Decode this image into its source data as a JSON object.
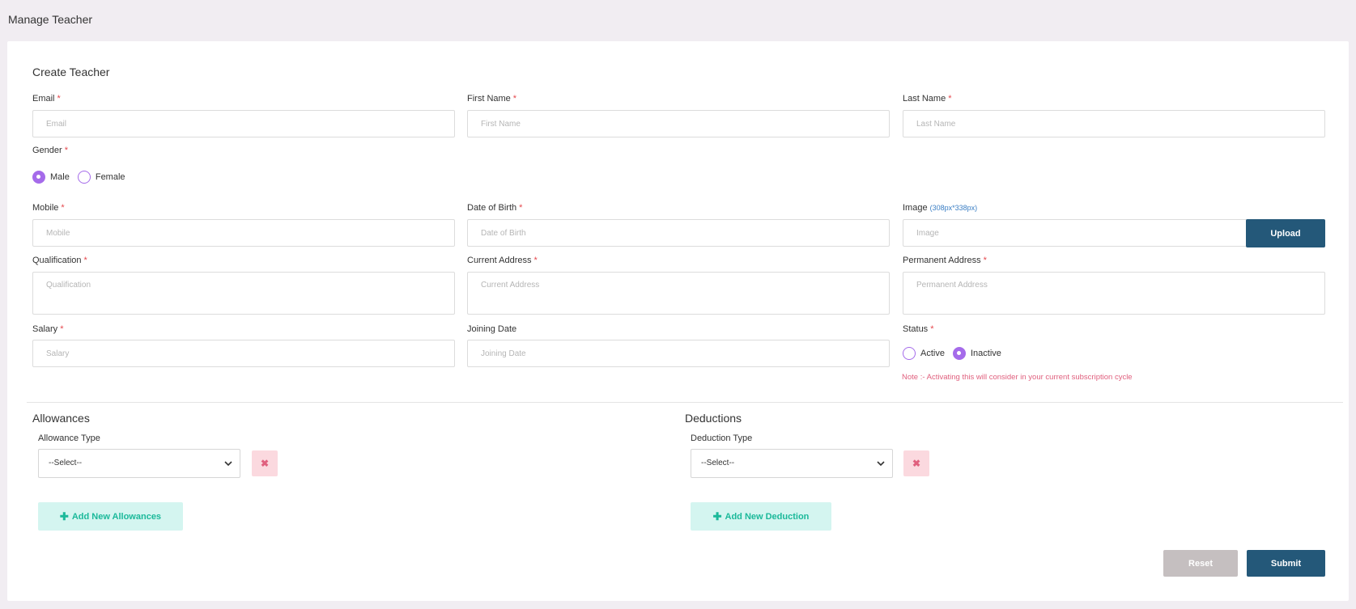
{
  "page": {
    "title": "Manage Teacher"
  },
  "form": {
    "title": "Create Teacher",
    "required_marker": "*",
    "email": {
      "label": "Email",
      "placeholder": "Email",
      "value": ""
    },
    "first_name": {
      "label": "First Name",
      "placeholder": "First Name",
      "value": ""
    },
    "last_name": {
      "label": "Last Name",
      "placeholder": "Last Name",
      "value": ""
    },
    "gender": {
      "label": "Gender",
      "options": [
        {
          "label": "Male",
          "selected": true
        },
        {
          "label": "Female",
          "selected": false
        }
      ]
    },
    "mobile": {
      "label": "Mobile",
      "placeholder": "Mobile",
      "value": ""
    },
    "dob": {
      "label": "Date of Birth",
      "placeholder": "Date of Birth",
      "value": ""
    },
    "image": {
      "label": "Image",
      "hint": "(308px*338px)",
      "placeholder": "Image",
      "upload_label": "Upload"
    },
    "qualification": {
      "label": "Qualification",
      "placeholder": "Qualification"
    },
    "current_address": {
      "label": "Current Address",
      "placeholder": "Current Address"
    },
    "permanent_address": {
      "label": "Permanent Address",
      "placeholder": "Permanent Address"
    },
    "salary": {
      "label": "Salary",
      "placeholder": "Salary"
    },
    "joining_date": {
      "label": "Joining Date",
      "placeholder": "Joining Date"
    },
    "status": {
      "label": "Status",
      "options": [
        {
          "label": "Active",
          "selected": false
        },
        {
          "label": "Inactive",
          "selected": true
        }
      ],
      "note": "Note :- Activating this will consider in your current subscription cycle"
    }
  },
  "allowances": {
    "title": "Allowances",
    "type_label": "Allowance Type",
    "selected": "--Select--",
    "remove_icon": "close-icon",
    "add_label": "Add New Allowances"
  },
  "deductions": {
    "title": "Deductions",
    "type_label": "Deduction Type",
    "selected": "--Select--",
    "remove_icon": "close-icon",
    "add_label": "Add New Deduction"
  },
  "actions": {
    "reset_label": "Reset",
    "submit_label": "Submit"
  },
  "colors": {
    "primary": "#245879",
    "radio_accent": "#a56bea",
    "required": "#e5484d",
    "note": "#e0607e",
    "add_button_bg": "#d4f5f0",
    "add_button_text": "#1bb99a",
    "page_bg": "#f1edf2"
  }
}
